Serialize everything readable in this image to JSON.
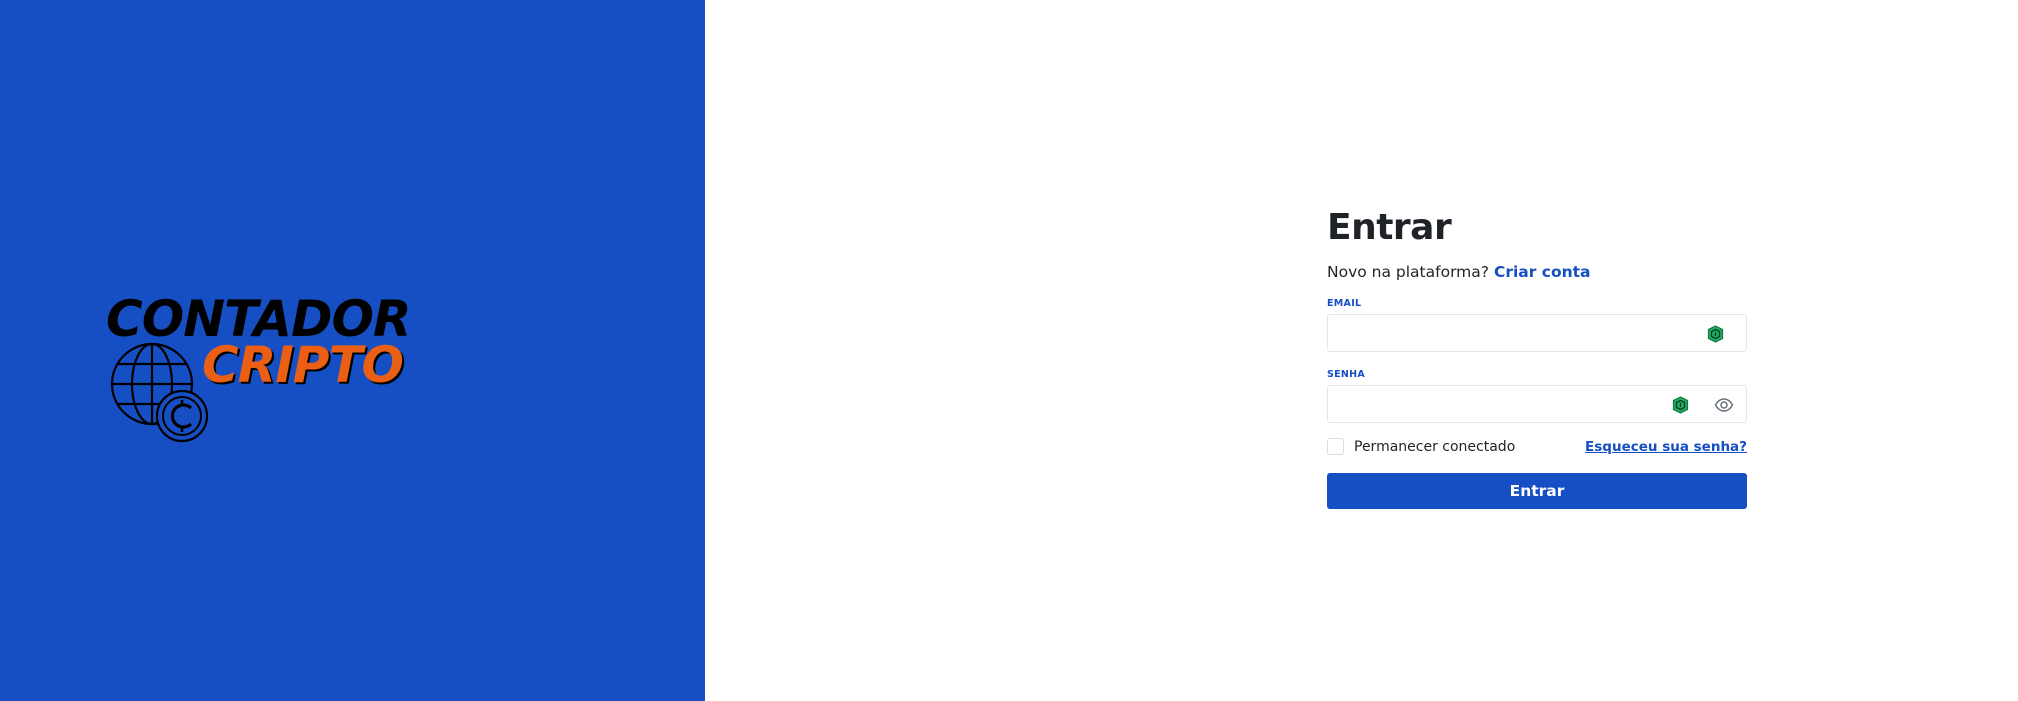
{
  "brand": {
    "line1": "CONTADOR",
    "line2": "CRIPTO",
    "primary_color": "#164fc3",
    "accent_color": "#ea5f14"
  },
  "login": {
    "title": "Entrar",
    "subtitle_text": "Novo na plataforma?",
    "create_account_link": "Criar conta",
    "email_label": "EMAIL",
    "email_value": "",
    "password_label": "SENHA",
    "password_value": "",
    "remember_label": "Permanecer conectado",
    "remember_checked": false,
    "forgot_link": "Esqueceu sua senha?",
    "submit_label": "Entrar"
  },
  "icons": {
    "email_field": "password-manager-shield-icon",
    "password_field": [
      "password-manager-shield-icon",
      "eye-icon"
    ]
  }
}
